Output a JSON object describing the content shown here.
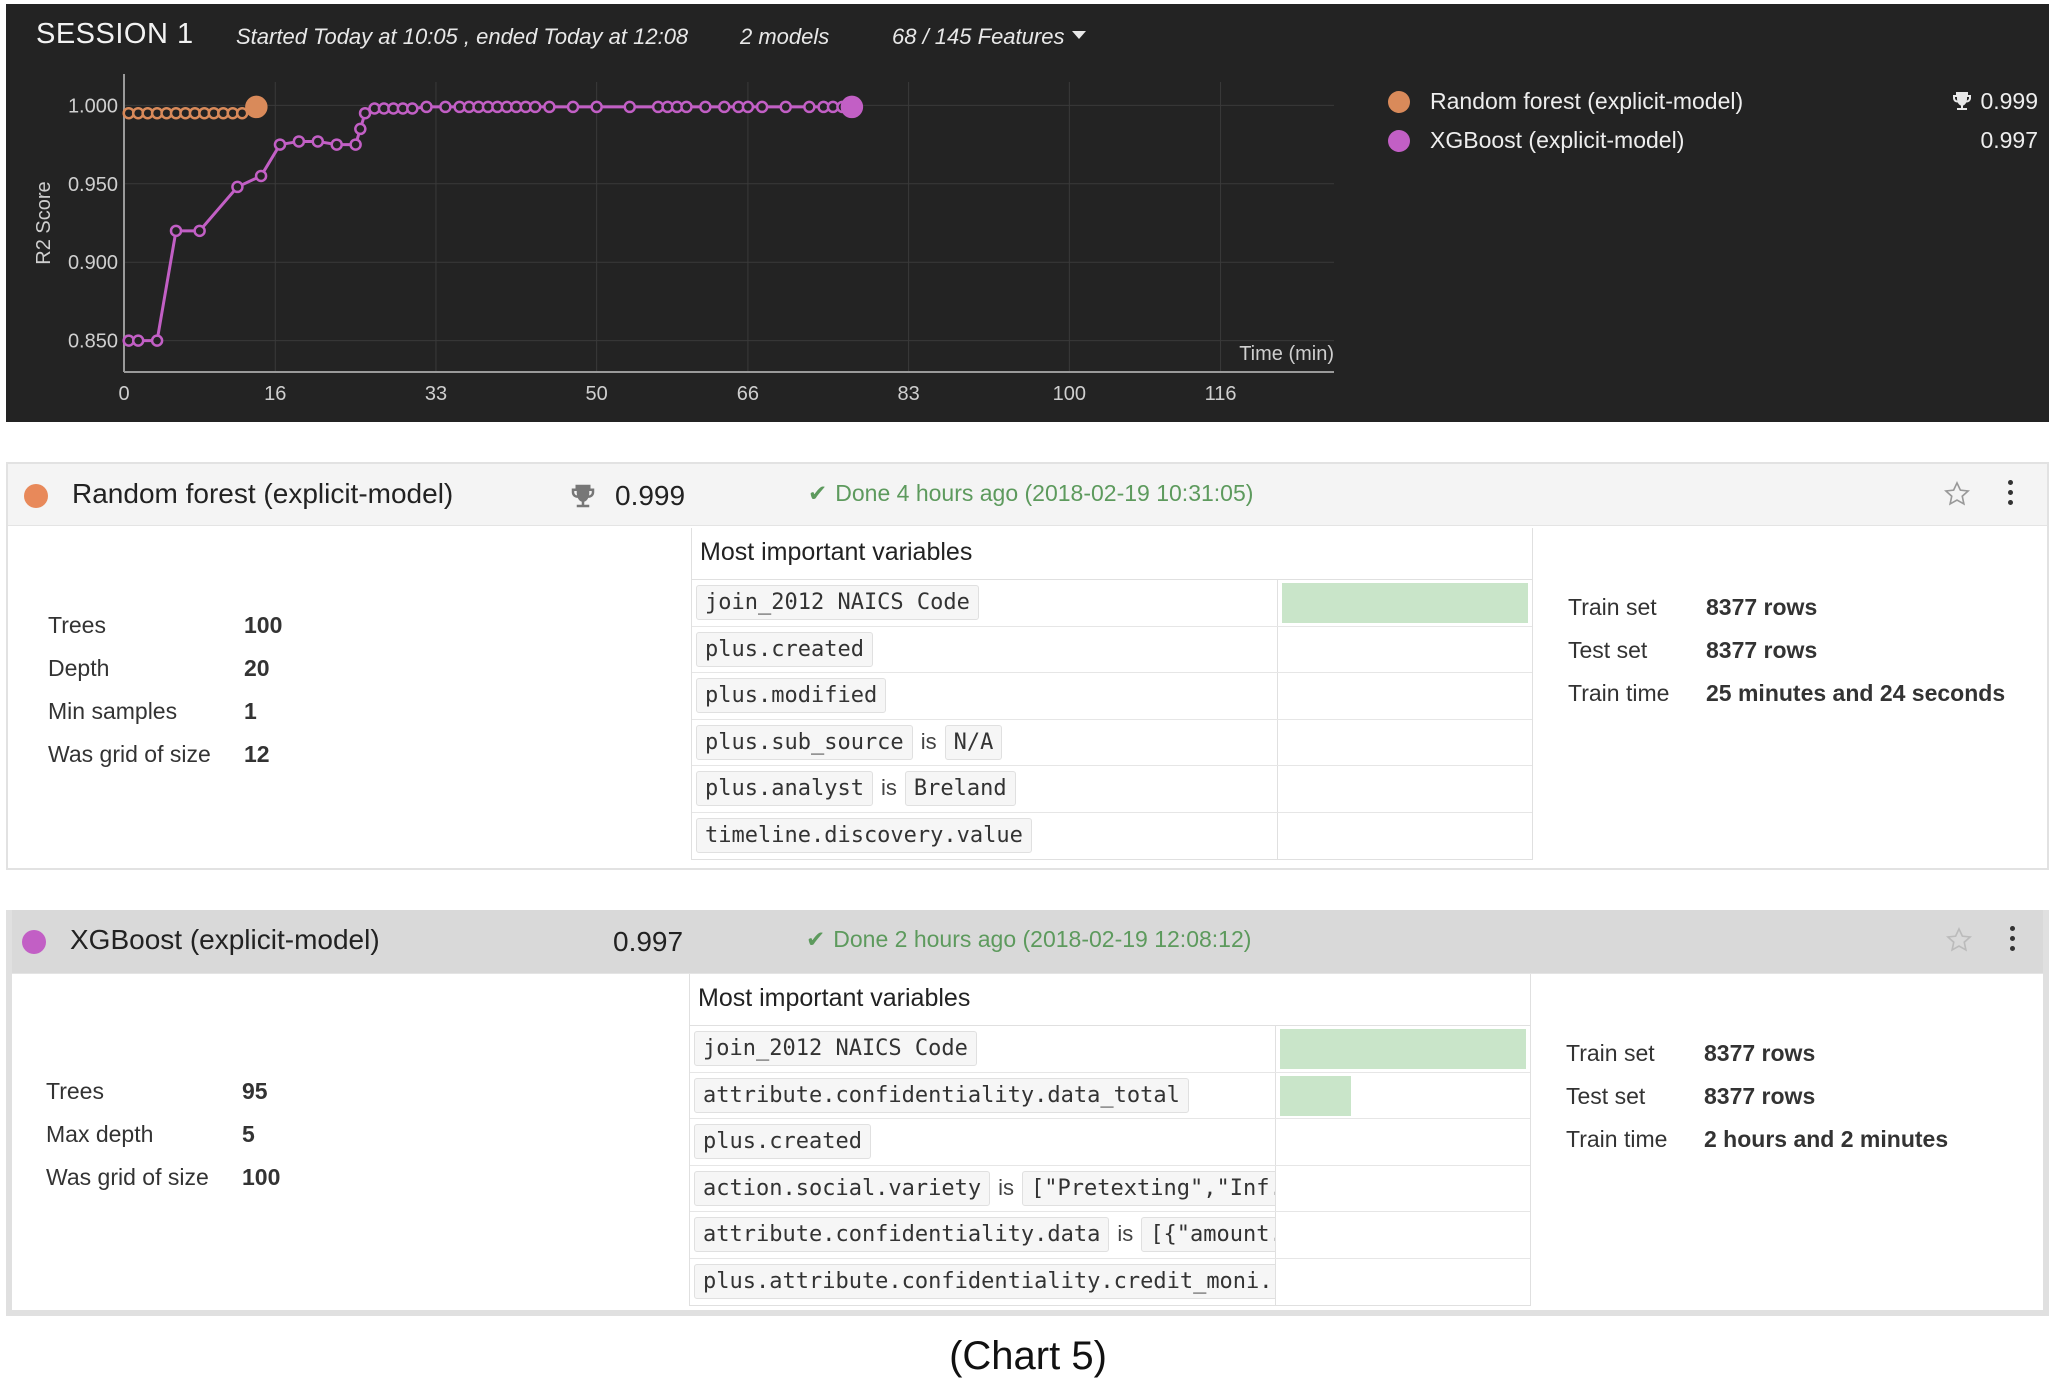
{
  "session": {
    "title": "SESSION 1",
    "time_range": "Started Today at 10:05 , ended Today at 12:08",
    "models_count": "2 models",
    "features": "68 / 145 Features"
  },
  "colors": {
    "random_forest": "#d98a5a",
    "xgboost": "#c25fc5",
    "panel_bg": "#232323",
    "done_green": "#5d9a5d",
    "bar_green": "#c9e5c9"
  },
  "chart_data": {
    "type": "line",
    "xlabel": "Time (min)",
    "ylabel": "R2 Score",
    "x_ticks": [
      0,
      16,
      33,
      50,
      66,
      83,
      100,
      116
    ],
    "y_ticks": [
      "1.000",
      "0.950",
      "0.900",
      "0.850"
    ],
    "xlim": [
      0,
      128
    ],
    "ylim": [
      0.83,
      1.02
    ],
    "grid": true,
    "legend_position": "right",
    "series": [
      {
        "name": "Random forest (explicit-model)",
        "color": "#d98a5a",
        "x": [
          0.5,
          1.5,
          2.5,
          3.5,
          4.5,
          5.5,
          6.5,
          7.5,
          8.5,
          9.5,
          10.5,
          11.5,
          12.5,
          14
        ],
        "y": [
          0.995,
          0.995,
          0.995,
          0.995,
          0.995,
          0.995,
          0.995,
          0.995,
          0.995,
          0.995,
          0.995,
          0.995,
          0.995,
          0.999
        ]
      },
      {
        "name": "XGBoost (explicit-model)",
        "color": "#c25fc5",
        "x": [
          0.5,
          1.5,
          3.5,
          5.5,
          8,
          12,
          14.5,
          16.5,
          18.5,
          20.5,
          22.5,
          24.5,
          25,
          25.5,
          26.5,
          27.5,
          28.5,
          29.5,
          30.5,
          32,
          34,
          35.5,
          36.5,
          37.5,
          38.5,
          39.5,
          40.5,
          41.5,
          42.5,
          43.5,
          45,
          47.5,
          50,
          53.5,
          56.5,
          57.5,
          58.5,
          59.5,
          61.5,
          63.5,
          65,
          66,
          67.5,
          70,
          72.5,
          74,
          75,
          76,
          77
        ],
        "y": [
          0.85,
          0.85,
          0.85,
          0.92,
          0.92,
          0.948,
          0.955,
          0.975,
          0.977,
          0.977,
          0.975,
          0.975,
          0.985,
          0.995,
          0.998,
          0.998,
          0.998,
          0.998,
          0.998,
          0.999,
          0.999,
          0.999,
          0.999,
          0.999,
          0.999,
          0.999,
          0.999,
          0.999,
          0.999,
          0.999,
          0.999,
          0.999,
          0.999,
          0.999,
          0.999,
          0.999,
          0.999,
          0.999,
          0.999,
          0.999,
          0.999,
          0.999,
          0.999,
          0.999,
          0.999,
          0.999,
          0.999,
          0.999,
          0.999
        ]
      }
    ]
  },
  "legend": [
    {
      "name": "Random forest (explicit-model)",
      "score": "0.999",
      "color": "#d98a5a",
      "best": true
    },
    {
      "name": "XGBoost (explicit-model)",
      "score": "0.997",
      "color": "#c25fc5",
      "best": false
    }
  ],
  "models": [
    {
      "name": "Random forest (explicit-model)",
      "score": "0.999",
      "status": "Done 4 hours ago (2018-02-19 10:31:05)",
      "params": [
        {
          "label": "Trees",
          "value": "100"
        },
        {
          "label": "Depth",
          "value": "20"
        },
        {
          "label": "Min samples",
          "value": "1"
        },
        {
          "label": "Was grid of size",
          "value": "12"
        }
      ],
      "vars_title": "Most important variables",
      "variables": [
        {
          "name": "join_2012 NAICS Code",
          "is": "",
          "value": "",
          "importance": 1.0
        },
        {
          "name": "plus.created",
          "is": "",
          "value": "",
          "importance": 0
        },
        {
          "name": "plus.modified",
          "is": "",
          "value": "",
          "importance": 0
        },
        {
          "name": "plus.sub_source",
          "is": "is",
          "value": "N/A",
          "importance": 0
        },
        {
          "name": "plus.analyst",
          "is": "is",
          "value": "Breland",
          "importance": 0
        },
        {
          "name": "timeline.discovery.value",
          "is": "",
          "value": "",
          "importance": 0
        }
      ],
      "stats": [
        {
          "label": "Train set",
          "value": "8377 rows"
        },
        {
          "label": "Test set",
          "value": "8377 rows"
        },
        {
          "label": "Train time",
          "value": "25 minutes and 24 seconds"
        }
      ]
    },
    {
      "name": "XGBoost (explicit-model)",
      "score": "0.997",
      "status": "Done 2 hours ago (2018-02-19 12:08:12)",
      "params": [
        {
          "label": "Trees",
          "value": "95"
        },
        {
          "label": "Max depth",
          "value": "5"
        },
        {
          "label": "Was grid of size",
          "value": "100"
        }
      ],
      "vars_title": "Most important variables",
      "variables": [
        {
          "name": "join_2012 NAICS Code",
          "is": "",
          "value": "",
          "importance": 1.0
        },
        {
          "name": "attribute.confidentiality.data_total",
          "is": "",
          "value": "",
          "importance": 0.29
        },
        {
          "name": "plus.created",
          "is": "",
          "value": "",
          "importance": 0
        },
        {
          "name": "action.social.variety",
          "is": "is",
          "value": "[\"Pretexting\",\"Inf...",
          "importance": 0
        },
        {
          "name": "attribute.confidentiality.data",
          "is": "is",
          "value": "[{\"amount...",
          "importance": 0
        },
        {
          "name": "plus.attribute.confidentiality.credit_moni...",
          "is": "",
          "value": "",
          "importance": 0
        }
      ],
      "stats": [
        {
          "label": "Train set",
          "value": "8377 rows"
        },
        {
          "label": "Test set",
          "value": "8377 rows"
        },
        {
          "label": "Train time",
          "value": "2 hours and 2 minutes"
        }
      ]
    }
  ],
  "caption": "(Chart 5)"
}
